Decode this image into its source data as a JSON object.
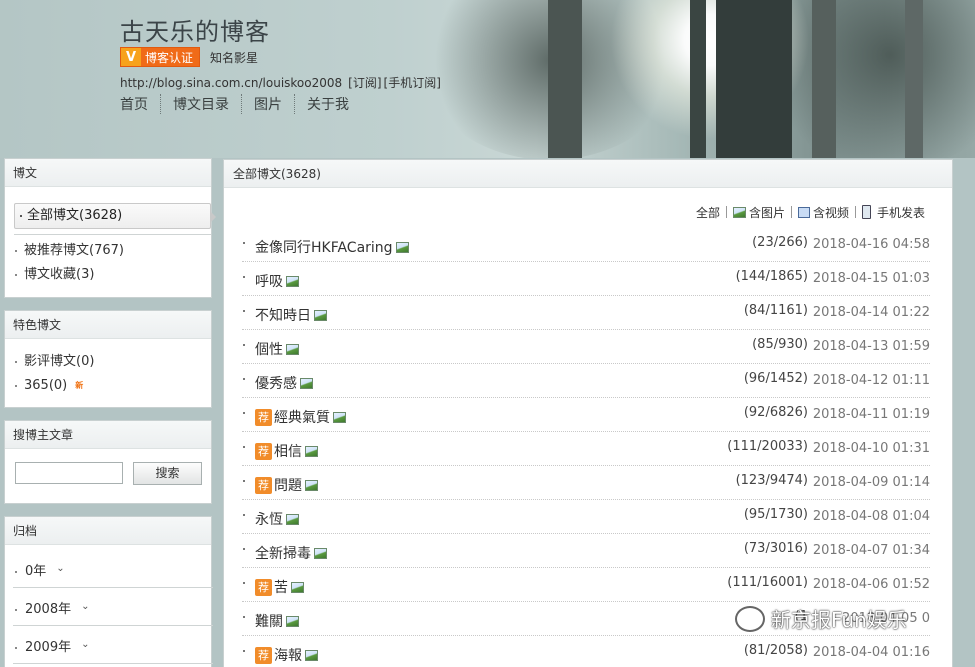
{
  "header": {
    "blog_title": "古天乐的博客",
    "verify_v": "V",
    "verify_badge": "博客认证",
    "verify_label": "知名影星",
    "url": "http://blog.sina.com.cn/louiskoo2008",
    "subscribe": "[订阅]",
    "mobile_subscribe": "[手机订阅]",
    "nav": [
      "首页",
      "博文目录",
      "图片",
      "关于我"
    ]
  },
  "sidebar": {
    "posts_panel": {
      "title": "博文",
      "selected": "全部博文(3628)",
      "items": [
        "被推荐博文(767)",
        "博文收藏(3)"
      ]
    },
    "featured_panel": {
      "title": "特色博文",
      "items": [
        "影评博文(0)",
        "365(0)"
      ],
      "new_badge": "新"
    },
    "search_panel": {
      "title": "搜博主文章",
      "input_value": "",
      "button": "搜索"
    },
    "archive_panel": {
      "title": "归档",
      "items": [
        "0年",
        "2008年",
        "2009年"
      ],
      "chevron": "⌄"
    }
  },
  "main": {
    "title": "全部博文(3628)",
    "filters": [
      "全部",
      "含图片",
      "含视频",
      "手机发表"
    ],
    "rec_badge": "荐",
    "posts": [
      {
        "title": "金像同行HKFACaring",
        "recommended": false,
        "stats": "(23/266)",
        "date": "2018-04-16 04:58"
      },
      {
        "title": "呼吸",
        "recommended": false,
        "stats": "(144/1865)",
        "date": "2018-04-15 01:03"
      },
      {
        "title": "不知時日",
        "recommended": false,
        "stats": "(84/1161)",
        "date": "2018-04-14 01:22"
      },
      {
        "title": "個性",
        "recommended": false,
        "stats": "(85/930)",
        "date": "2018-04-13 01:59"
      },
      {
        "title": "優秀感",
        "recommended": false,
        "stats": "(96/1452)",
        "date": "2018-04-12 01:11"
      },
      {
        "title": "經典氣質",
        "recommended": true,
        "stats": "(92/6826)",
        "date": "2018-04-11 01:19"
      },
      {
        "title": "相信",
        "recommended": true,
        "stats": "(111/20033)",
        "date": "2018-04-10 01:31"
      },
      {
        "title": "問題",
        "recommended": true,
        "stats": "(123/9474)",
        "date": "2018-04-09 01:14"
      },
      {
        "title": "永恆",
        "recommended": false,
        "stats": "(95/1730)",
        "date": "2018-04-08 01:04"
      },
      {
        "title": "全新掃毒",
        "recommended": false,
        "stats": "(73/3016)",
        "date": "2018-04-07 01:34"
      },
      {
        "title": "苦",
        "recommended": true,
        "stats": "(111/16001)",
        "date": "2018-04-06 01:52"
      },
      {
        "title": "難關",
        "recommended": false,
        "stats": "(1",
        "date": "2018-04-05 0"
      },
      {
        "title": "海報",
        "recommended": true,
        "stats": "(81/2058)",
        "date": "2018-04-04 01:16"
      }
    ]
  },
  "watermark": "新京报Fun娱乐",
  "colors": {
    "verify_orange": "#f06b18",
    "rec_orange": "#f18c2a",
    "page_bg": "#b3c4c4"
  }
}
